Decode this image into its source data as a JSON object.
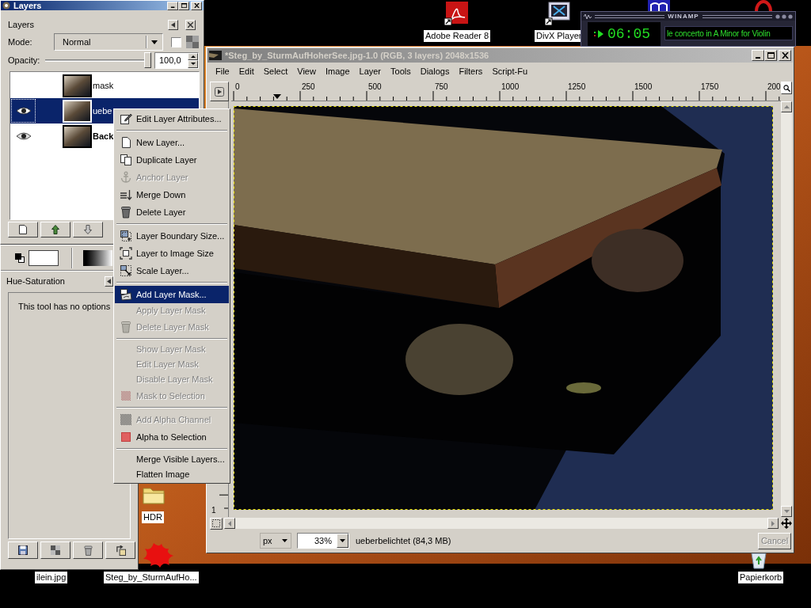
{
  "layers_window": {
    "title": "Layers",
    "active": true,
    "tab_label": "Layers",
    "mode_label": "Mode:",
    "mode": "Normal",
    "keep_transparency": false,
    "opacity_label": "Opacity:",
    "opacity": {
      "level": 1,
      "value": "100,0"
    },
    "layers": [
      {
        "name": "mask",
        "visible": false,
        "selected": false,
        "bold": false
      },
      {
        "name": "uebe",
        "visible": true,
        "selected": true,
        "bold": false
      },
      {
        "name": "Back",
        "visible": true,
        "selected": false,
        "bold": true
      }
    ]
  },
  "tool_options": {
    "title": "Hue-Saturation",
    "message": "This tool has no options"
  },
  "image_window": {
    "title": "*Steg_by_SturmAufHoherSee.jpg-1.0 (RGB, 3 layers) 2048x1536",
    "active": false,
    "menu": [
      "File",
      "Edit",
      "Select",
      "View",
      "Image",
      "Layer",
      "Tools",
      "Dialogs",
      "Filters",
      "Script-Fu"
    ],
    "ruler_labels": [
      "0",
      "250",
      "500",
      "750",
      "1000",
      "1250",
      "1500",
      "1750",
      "200"
    ],
    "vertical_ruler_labels": [
      "1"
    ],
    "unit": "px",
    "zoom": "33%",
    "status": "ueberbelichtet (84,3 MB)",
    "cancel": {
      "label": "Cancel",
      "disabled": true
    }
  },
  "context_menu": {
    "groups": [
      [
        {
          "label": "Edit Layer Attributes...",
          "disabled": false,
          "selected": false
        }
      ],
      [
        {
          "label": "New Layer...",
          "disabled": false,
          "selected": false
        },
        {
          "label": "Duplicate Layer",
          "disabled": false,
          "selected": false
        },
        {
          "label": "Anchor Layer",
          "disabled": true,
          "selected": false
        },
        {
          "label": "Merge Down",
          "disabled": false,
          "selected": false
        },
        {
          "label": "Delete Layer",
          "disabled": false,
          "selected": false
        }
      ],
      [
        {
          "label": "Layer Boundary Size...",
          "disabled": false,
          "selected": false
        },
        {
          "label": "Layer to Image Size",
          "disabled": false,
          "selected": false
        },
        {
          "label": "Scale Layer...",
          "disabled": false,
          "selected": false
        }
      ],
      [
        {
          "label": "Add Layer Mask...",
          "disabled": false,
          "selected": true
        },
        {
          "label": "Apply Layer Mask",
          "disabled": true,
          "selected": false
        },
        {
          "label": "Delete Layer Mask",
          "disabled": true,
          "selected": false
        }
      ],
      [
        {
          "label": "Show Layer Mask",
          "disabled": true,
          "selected": false
        },
        {
          "label": "Edit Layer Mask",
          "disabled": true,
          "selected": false
        },
        {
          "label": "Disable Layer Mask",
          "disabled": true,
          "selected": false
        },
        {
          "label": "Mask to Selection",
          "disabled": true,
          "selected": false
        }
      ],
      [
        {
          "label": "Add Alpha Channel",
          "disabled": true,
          "selected": false
        },
        {
          "label": "Alpha to Selection",
          "disabled": false,
          "selected": false
        }
      ],
      [
        {
          "label": "Merge Visible Layers...",
          "disabled": false,
          "selected": false
        },
        {
          "label": "Flatten Image",
          "disabled": false,
          "selected": false
        }
      ]
    ]
  },
  "player": {
    "title": "WINAMP",
    "time": "06:05",
    "song": "le concerto in A Minor for Violin"
  },
  "desktop": {
    "icons": [
      {
        "label": "Adobe Reader 8"
      },
      {
        "label": "DivX Player"
      },
      {
        "label": "HDR"
      },
      {
        "label": "ilein.jpg"
      },
      {
        "label": "Steg_by_SturmAufHo..."
      },
      {
        "label": "Papierkorb"
      }
    ]
  }
}
